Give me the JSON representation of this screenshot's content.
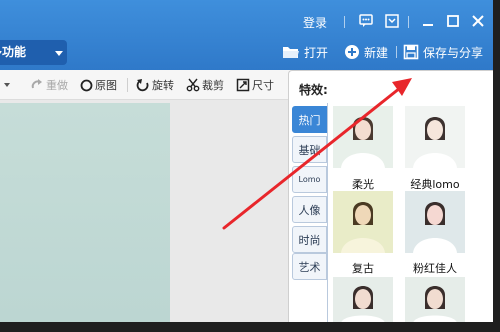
{
  "title_bar": {
    "login_label": "登录",
    "menu_label": "多功能"
  },
  "top_actions": {
    "open_label": "打开",
    "new_label": "新建",
    "save_share_label": "保存与分享"
  },
  "toolbar": {
    "redo_label": "重做",
    "original_label": "原图",
    "rotate_label": "旋转",
    "crop_label": "裁剪",
    "size_label": "尺寸"
  },
  "effects_panel": {
    "title": "特效:",
    "categories": [
      {
        "label": "热门",
        "active": true
      },
      {
        "label": "基础",
        "active": false
      },
      {
        "label": "Lomo",
        "active": false
      },
      {
        "label": "人像",
        "active": false
      },
      {
        "label": "时尚",
        "active": false
      },
      {
        "label": "艺术",
        "active": false
      }
    ],
    "thumbnails": [
      {
        "label": "柔光",
        "bg": "#e8f0ea"
      },
      {
        "label": "经典lomo",
        "bg": "#f1f4f2"
      },
      {
        "label": "复古",
        "bg": "#e9ecc8"
      },
      {
        "label": "粉红佳人",
        "bg": "#dfe8ea"
      },
      {
        "label": "",
        "bg": "#e6ede9"
      },
      {
        "label": "",
        "bg": "#e6ede9"
      }
    ]
  },
  "colors": {
    "title_bar": "#3a86d6",
    "menu_tab": "#1f5fae",
    "annotation_arrow": "#e8262b"
  }
}
